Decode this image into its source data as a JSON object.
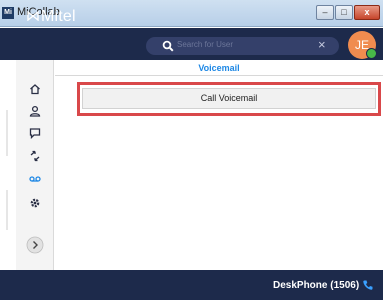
{
  "window": {
    "title": "MiCollab",
    "icon_text": "Mi",
    "minimize": "–",
    "maximize": "□",
    "close": "x"
  },
  "header": {
    "brand": "Mitel",
    "search_placeholder": "Search for User",
    "search_clear": "×",
    "avatar_initials": "JE",
    "presence_color": "#48b848"
  },
  "sidebar": {
    "items": [
      {
        "name": "home",
        "active": false
      },
      {
        "name": "contacts",
        "active": false
      },
      {
        "name": "chat",
        "active": false
      },
      {
        "name": "calls",
        "active": false
      },
      {
        "name": "voicemail",
        "active": true
      },
      {
        "name": "settings",
        "active": false
      }
    ],
    "expand": "›"
  },
  "main": {
    "tab_title": "Voicemail",
    "call_voicemail_label": "Call Voicemail"
  },
  "footer": {
    "device_label": "DeskPhone (1506)"
  },
  "colors": {
    "navy": "#1d2a4b",
    "accent": "#1e88e5",
    "highlight": "#d9484a",
    "avatar": "#f08c4f"
  }
}
